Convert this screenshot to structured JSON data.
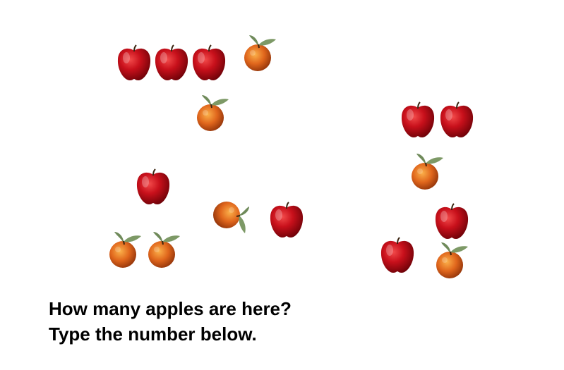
{
  "prompt": {
    "line1": "How many apples are here?",
    "line2": "Type the number below."
  },
  "scene": {
    "apple_count": 9,
    "orange_count": 7,
    "apple_icon": "red-apple-icon",
    "orange_icon": "orange-with-leaves-icon",
    "apple_color": "#c8101b",
    "orange_color": "#e0661c",
    "leaf_color": "#6f8a5a"
  }
}
